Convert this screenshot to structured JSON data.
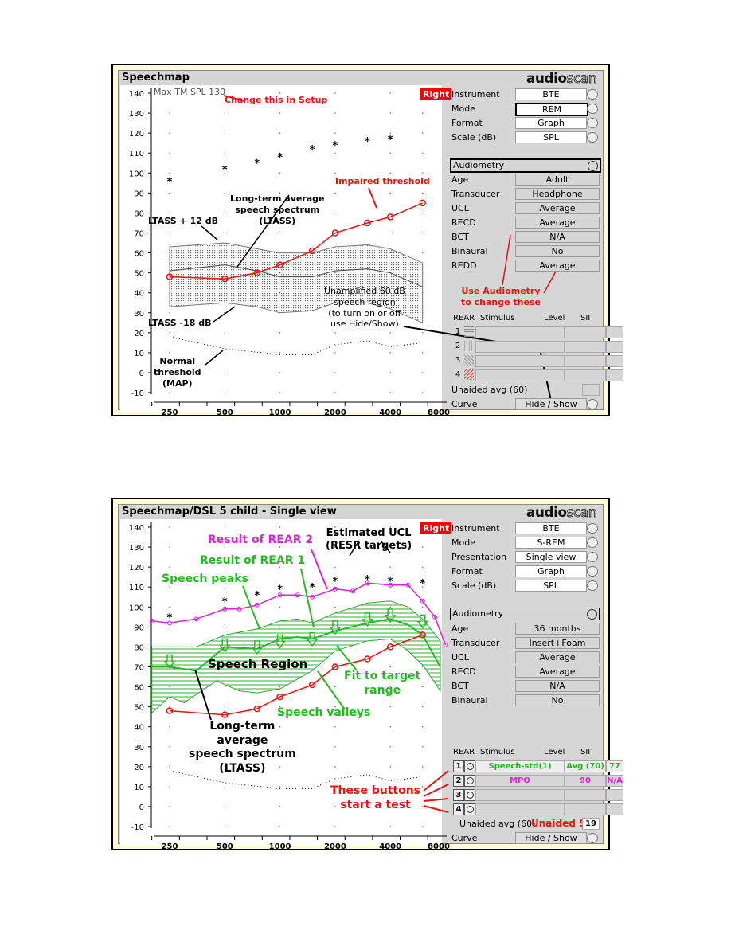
{
  "panels": [
    {
      "title": "Speechmap",
      "logo": {
        "a": "audio",
        "b": "scan"
      },
      "ear": "Right",
      "max_spl": "Max TM SPL 130",
      "controls": [
        {
          "label": "Instrument",
          "value": "BTE"
        },
        {
          "label": "Mode",
          "value": "REM"
        },
        {
          "label": "Format",
          "value": "Graph"
        },
        {
          "label": "Scale (dB)",
          "value": "SPL"
        }
      ],
      "audiometry": {
        "label": "Audiometry",
        "items": [
          {
            "label": "Age",
            "value": "Adult"
          },
          {
            "label": "Transducer",
            "value": "Headphone"
          },
          {
            "label": "UCL",
            "value": "Average"
          },
          {
            "label": "RECD",
            "value": "Average"
          },
          {
            "label": "BCT",
            "value": "N/A"
          },
          {
            "label": "Binaural",
            "value": "No"
          },
          {
            "label": "REDD",
            "value": "Average"
          }
        ]
      },
      "rear_table": {
        "headers": [
          "REAR",
          "Stimulus",
          "Level",
          "SII"
        ],
        "rows": [
          {
            "n": "1",
            "stimulus": "",
            "level": "",
            "sii": ""
          },
          {
            "n": "2",
            "stimulus": "",
            "level": "",
            "sii": ""
          },
          {
            "n": "3",
            "stimulus": "",
            "level": "",
            "sii": ""
          },
          {
            "n": "4",
            "stimulus": "",
            "level": "",
            "sii": ""
          }
        ],
        "unaided_label": "Unaided avg (60)",
        "unaided_value": "",
        "curve_label": "Curve",
        "curve_value": "Hide / Show"
      },
      "annotations": {
        "setup": "Change this in Setup",
        "impaired": "Impaired threshold",
        "ltass": [
          "Long-term average",
          "speech spectrum",
          "(LTASS)"
        ],
        "ltass_plus": "LTASS + 12 dB",
        "ltass_minus": "LTASS -18 dB",
        "unamplified": [
          "Unamplified 60 dB",
          "speech region",
          "(to turn on or off",
          "use Hide/Show)"
        ],
        "normal": [
          "Normal",
          "threshold",
          "(MAP)"
        ],
        "audiometry": [
          "Use Audiometry",
          "to change these"
        ]
      },
      "chart_data": {
        "type": "line",
        "xscale": "log",
        "xticks": [
          "250",
          "500",
          "1000",
          "2000",
          "4000",
          "8000"
        ],
        "yticks": [
          "140",
          "130",
          "120",
          "110",
          "100",
          "90",
          "80",
          "70",
          "60",
          "50",
          "40",
          "30",
          "20",
          "10",
          "0",
          "-10"
        ],
        "ylim": [
          -10,
          140
        ],
        "ucl": [
          [
            250,
            96
          ],
          [
            500,
            102
          ],
          [
            750,
            105
          ],
          [
            1000,
            108
          ],
          [
            1500,
            112
          ],
          [
            2000,
            114
          ],
          [
            3000,
            116
          ],
          [
            4000,
            117
          ]
        ],
        "impaired_threshold": [
          [
            250,
            48
          ],
          [
            500,
            47
          ],
          [
            750,
            50
          ],
          [
            1000,
            54
          ],
          [
            1500,
            61
          ],
          [
            2000,
            70
          ],
          [
            3000,
            75
          ],
          [
            4000,
            78
          ],
          [
            6000,
            85
          ]
        ],
        "ltass_upper": [
          [
            250,
            63
          ],
          [
            500,
            65
          ],
          [
            750,
            62
          ],
          [
            1000,
            60
          ],
          [
            1500,
            60
          ],
          [
            2000,
            63
          ],
          [
            3000,
            64
          ],
          [
            4000,
            62
          ],
          [
            6000,
            55
          ]
        ],
        "ltass": [
          [
            250,
            51
          ],
          [
            500,
            54
          ],
          [
            750,
            51
          ],
          [
            1000,
            48
          ],
          [
            1500,
            48
          ],
          [
            2000,
            51
          ],
          [
            3000,
            52
          ],
          [
            4000,
            50
          ],
          [
            6000,
            43
          ]
        ],
        "ltass_lower": [
          [
            250,
            33
          ],
          [
            500,
            35
          ],
          [
            750,
            33
          ],
          [
            1000,
            30
          ],
          [
            1500,
            31
          ],
          [
            2000,
            35
          ],
          [
            3000,
            35
          ],
          [
            4000,
            32
          ],
          [
            6000,
            25
          ]
        ],
        "normal_threshold": [
          [
            250,
            18
          ],
          [
            500,
            12
          ],
          [
            1000,
            9
          ],
          [
            1500,
            9
          ],
          [
            2000,
            14
          ],
          [
            3000,
            16
          ],
          [
            4000,
            13
          ],
          [
            6000,
            15
          ]
        ]
      }
    },
    {
      "title": "Speechmap/DSL 5 child - Single view",
      "logo": {
        "a": "audio",
        "b": "scan"
      },
      "ear": "Right",
      "controls": [
        {
          "label": "Instrument",
          "value": "BTE"
        },
        {
          "label": "Mode",
          "value": "S-REM"
        },
        {
          "label": "Presentation",
          "value": "Single view"
        },
        {
          "label": "Format",
          "value": "Graph"
        },
        {
          "label": "Scale (dB)",
          "value": "SPL"
        }
      ],
      "audiometry": {
        "label": "Audiometry",
        "items": [
          {
            "label": "Age",
            "value": "36 months"
          },
          {
            "label": "Transducer",
            "value": "Insert+Foam"
          },
          {
            "label": "UCL",
            "value": "Average"
          },
          {
            "label": "RECD",
            "value": "Average"
          },
          {
            "label": "BCT",
            "value": "N/A"
          },
          {
            "label": "Binaural",
            "value": "No"
          }
        ]
      },
      "rear_table": {
        "headers": [
          "REAR",
          "Stimulus",
          "Level",
          "SII"
        ],
        "rows": [
          {
            "n": "1",
            "stimulus": "Speech-std(1)",
            "level": "Avg (70)",
            "sii": "77",
            "color": "#22bb22"
          },
          {
            "n": "2",
            "stimulus": "MPO",
            "level": "90",
            "sii": "N/A",
            "color": "#dd22dd"
          },
          {
            "n": "3",
            "stimulus": "",
            "level": "",
            "sii": ""
          },
          {
            "n": "4",
            "stimulus": "",
            "level": "",
            "sii": ""
          }
        ],
        "unaided_label": "Unaided avg (60)",
        "unaided_value": "19",
        "curve_label": "Curve",
        "curve_value": "Hide / Show"
      },
      "annotations": {
        "rear2": "Result of REAR 2",
        "ucl": [
          "Estimated UCL",
          "(RESR targets)"
        ],
        "rear1": "Result of REAR 1",
        "peaks": "Speech peaks",
        "region": "Speech Region",
        "fit": [
          "Fit to target",
          "range"
        ],
        "valleys": "Speech valleys",
        "ltass": [
          "Long-term",
          "average",
          "speech spectrum",
          "(LTASS)"
        ],
        "buttons": [
          "These buttons",
          "start a test"
        ],
        "unaided_sii": "Unaided SII"
      },
      "chart_data": {
        "type": "line",
        "xscale": "log",
        "xticks": [
          "250",
          "500",
          "1000",
          "2000",
          "4000",
          "8000"
        ],
        "yticks": [
          "140",
          "130",
          "120",
          "110",
          "100",
          "90",
          "80",
          "70",
          "60",
          "50",
          "40",
          "30",
          "20",
          "10",
          "0",
          "-10"
        ],
        "ylim": [
          -10,
          140
        ],
        "ucl": [
          [
            250,
            95
          ],
          [
            500,
            103
          ],
          [
            750,
            106
          ],
          [
            1000,
            109
          ],
          [
            1500,
            110
          ],
          [
            2000,
            113
          ],
          [
            3000,
            114
          ],
          [
            4000,
            113
          ],
          [
            6000,
            112
          ]
        ],
        "rear2": [
          [
            200,
            93
          ],
          [
            250,
            92
          ],
          [
            350,
            94
          ],
          [
            500,
            99
          ],
          [
            600,
            99
          ],
          [
            750,
            101
          ],
          [
            1000,
            106
          ],
          [
            1250,
            106
          ],
          [
            1500,
            105
          ],
          [
            2000,
            109
          ],
          [
            2500,
            108
          ],
          [
            3000,
            112
          ],
          [
            4000,
            111
          ],
          [
            5000,
            111
          ],
          [
            6000,
            103
          ],
          [
            7000,
            95
          ],
          [
            8000,
            81
          ]
        ],
        "rear1": [
          [
            200,
            70
          ],
          [
            250,
            70
          ],
          [
            350,
            68
          ],
          [
            500,
            80
          ],
          [
            750,
            79
          ],
          [
            1000,
            84
          ],
          [
            1250,
            85
          ],
          [
            1500,
            84
          ],
          [
            2000,
            88
          ],
          [
            3000,
            92
          ],
          [
            4000,
            94
          ],
          [
            5000,
            91
          ],
          [
            6000,
            86
          ],
          [
            7500,
            70
          ]
        ],
        "speech_peaks": [
          [
            200,
            80
          ],
          [
            350,
            80
          ],
          [
            500,
            86
          ],
          [
            750,
            89
          ],
          [
            1000,
            93
          ],
          [
            1250,
            94
          ],
          [
            1500,
            92
          ],
          [
            2000,
            97
          ],
          [
            3000,
            102
          ],
          [
            4000,
            103
          ],
          [
            5000,
            100
          ],
          [
            6000,
            94
          ],
          [
            7500,
            83
          ]
        ],
        "speech_valleys": [
          [
            200,
            47
          ],
          [
            250,
            55
          ],
          [
            300,
            52
          ],
          [
            450,
            63
          ],
          [
            600,
            58
          ],
          [
            750,
            57
          ],
          [
            1000,
            59
          ],
          [
            1500,
            68
          ],
          [
            2000,
            78
          ],
          [
            3000,
            83
          ],
          [
            4000,
            84
          ],
          [
            5000,
            78
          ],
          [
            6000,
            71
          ],
          [
            7500,
            58
          ]
        ],
        "targets": [
          [
            250,
            72
          ],
          [
            500,
            80
          ],
          [
            750,
            79
          ],
          [
            1000,
            82
          ],
          [
            1500,
            83
          ],
          [
            2000,
            89
          ],
          [
            3000,
            93
          ],
          [
            4000,
            95
          ],
          [
            6000,
            92
          ]
        ],
        "impaired_threshold": [
          [
            250,
            48
          ],
          [
            500,
            46
          ],
          [
            750,
            49
          ],
          [
            1000,
            55
          ],
          [
            1500,
            61
          ],
          [
            2000,
            70
          ],
          [
            3000,
            74
          ],
          [
            4000,
            80
          ],
          [
            6000,
            86
          ]
        ],
        "normal_threshold": [
          [
            250,
            18
          ],
          [
            500,
            12
          ],
          [
            1000,
            9
          ],
          [
            1500,
            9
          ],
          [
            2000,
            14
          ],
          [
            3000,
            16
          ],
          [
            4000,
            13
          ],
          [
            6000,
            15
          ]
        ]
      }
    }
  ],
  "colors": {
    "red": "#ee1111",
    "green": "#22bb22",
    "magenta": "#dd22dd",
    "hatch_green": "#33aa33"
  }
}
